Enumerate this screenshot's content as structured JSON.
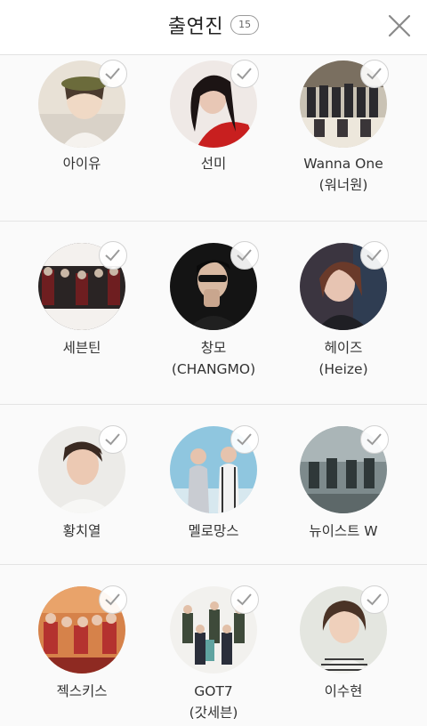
{
  "header": {
    "title": "출연진",
    "count": "15"
  },
  "artists": [
    {
      "line1": "아이유",
      "line2": ""
    },
    {
      "line1": "선미",
      "line2": ""
    },
    {
      "line1": "Wanna One",
      "line2": "(워너원)"
    },
    {
      "line1": "세븐틴",
      "line2": ""
    },
    {
      "line1": "창모",
      "line2": "(CHANGMO)"
    },
    {
      "line1": "헤이즈",
      "line2": "(Heize)"
    },
    {
      "line1": "황치열",
      "line2": ""
    },
    {
      "line1": "멜로망스",
      "line2": ""
    },
    {
      "line1": "뉴이스트 W",
      "line2": ""
    },
    {
      "line1": "젝스키스",
      "line2": ""
    },
    {
      "line1": "GOT7",
      "line2": "(갓세븐)"
    },
    {
      "line1": "이수현",
      "line2": ""
    }
  ],
  "colors": {
    "accent_border": "#d2d2d2",
    "check_stroke": "#9a9a9a",
    "header_bg": "#ffffff",
    "page_bg": "#f7f7f7"
  },
  "icons": {
    "close": "close-icon",
    "check": "check-icon"
  }
}
